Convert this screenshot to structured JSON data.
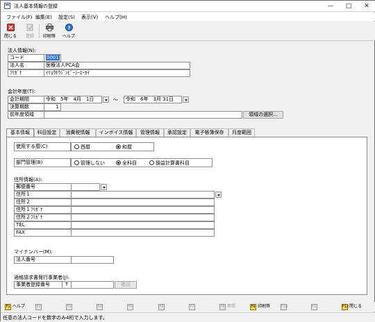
{
  "window": {
    "title": "法人基本情報の登録",
    "controls": [
      "—",
      "□",
      "✕"
    ]
  },
  "menu": [
    "ファイル(F)",
    "編集(E)",
    "設定(S)",
    "表示(V)",
    "ヘルプ(H)"
  ],
  "toolbar": {
    "close": "閉じる",
    "register": "登録",
    "print": "印刷等",
    "help": "ヘルプ"
  },
  "corp": {
    "section": "法人情報(N):",
    "code_label": "コード",
    "code_value": "0001",
    "name_label": "法人名",
    "name_value": "医療法人PCA会",
    "kana_label": "ﾌﾘｶﾞﾅ",
    "kana_value": "ｲﾘｮｳﾎｳｼﾞﾝﾋﾟｰｼｰｴｰｶｲ"
  },
  "fiscal": {
    "section": "会計年度(T):",
    "period_label": "会計期間",
    "from": "令和　5年　4月　1日",
    "tilde": "～",
    "to": "令和　6年　3月 31日",
    "term_label": "決算期数",
    "term_value": "1",
    "prev_label": "前年度領域",
    "select_btn": "領域の選択..."
  },
  "tabs": [
    "基本情報",
    "科目設定",
    "消費税情報",
    "インボイス情報",
    "管理情報",
    "承認設定",
    "電子帳簿保存",
    "月度範囲"
  ],
  "basic": {
    "calendar_label": "使用する暦(C)",
    "calendar_opt1": "西暦",
    "calendar_opt2": "和暦",
    "dept_label": "部門管理(B)",
    "dept_opt1": "管理しない",
    "dept_opt2": "全科目",
    "dept_opt3": "損益計算書科目",
    "address_section": "住所情報(A):",
    "address_rows": [
      "郵便番号",
      "住所１",
      "住所２",
      "住所１ﾌﾘｶﾞﾅ",
      "住所２ﾌﾘｶﾞﾅ",
      "TEL",
      "FAX"
    ],
    "mynumber_section": "マイナンバー(M):",
    "corp_number_label": "法人番号",
    "invoice_section": "適格請求書発行事業者(J):",
    "invoice_label": "事業者登録番号",
    "invoice_prefix": "T",
    "invoice_btn": "確認"
  },
  "fkeys": [
    {
      "key": "F1",
      "label": "ヘルプ",
      "on": true
    },
    {
      "key": "F2",
      "label": "",
      "on": false
    },
    {
      "key": "F3",
      "label": "",
      "on": false
    },
    {
      "key": "F4",
      "label": "",
      "on": false
    },
    {
      "key": "F5",
      "label": "",
      "on": false
    },
    {
      "key": "F6",
      "label": "",
      "on": false
    },
    {
      "key": "F7",
      "label": "",
      "on": false
    },
    {
      "key": "F8",
      "label": "参照",
      "on": false
    },
    {
      "key": "F9",
      "label": "印刷等",
      "on": true
    },
    {
      "key": "F10",
      "label": "",
      "on": false
    },
    {
      "key": "F11",
      "label": "",
      "on": false
    },
    {
      "key": "F12",
      "label": "閉じる",
      "on": true
    }
  ],
  "status": "任意の法人コードを数字のみ4桁で入力します。"
}
